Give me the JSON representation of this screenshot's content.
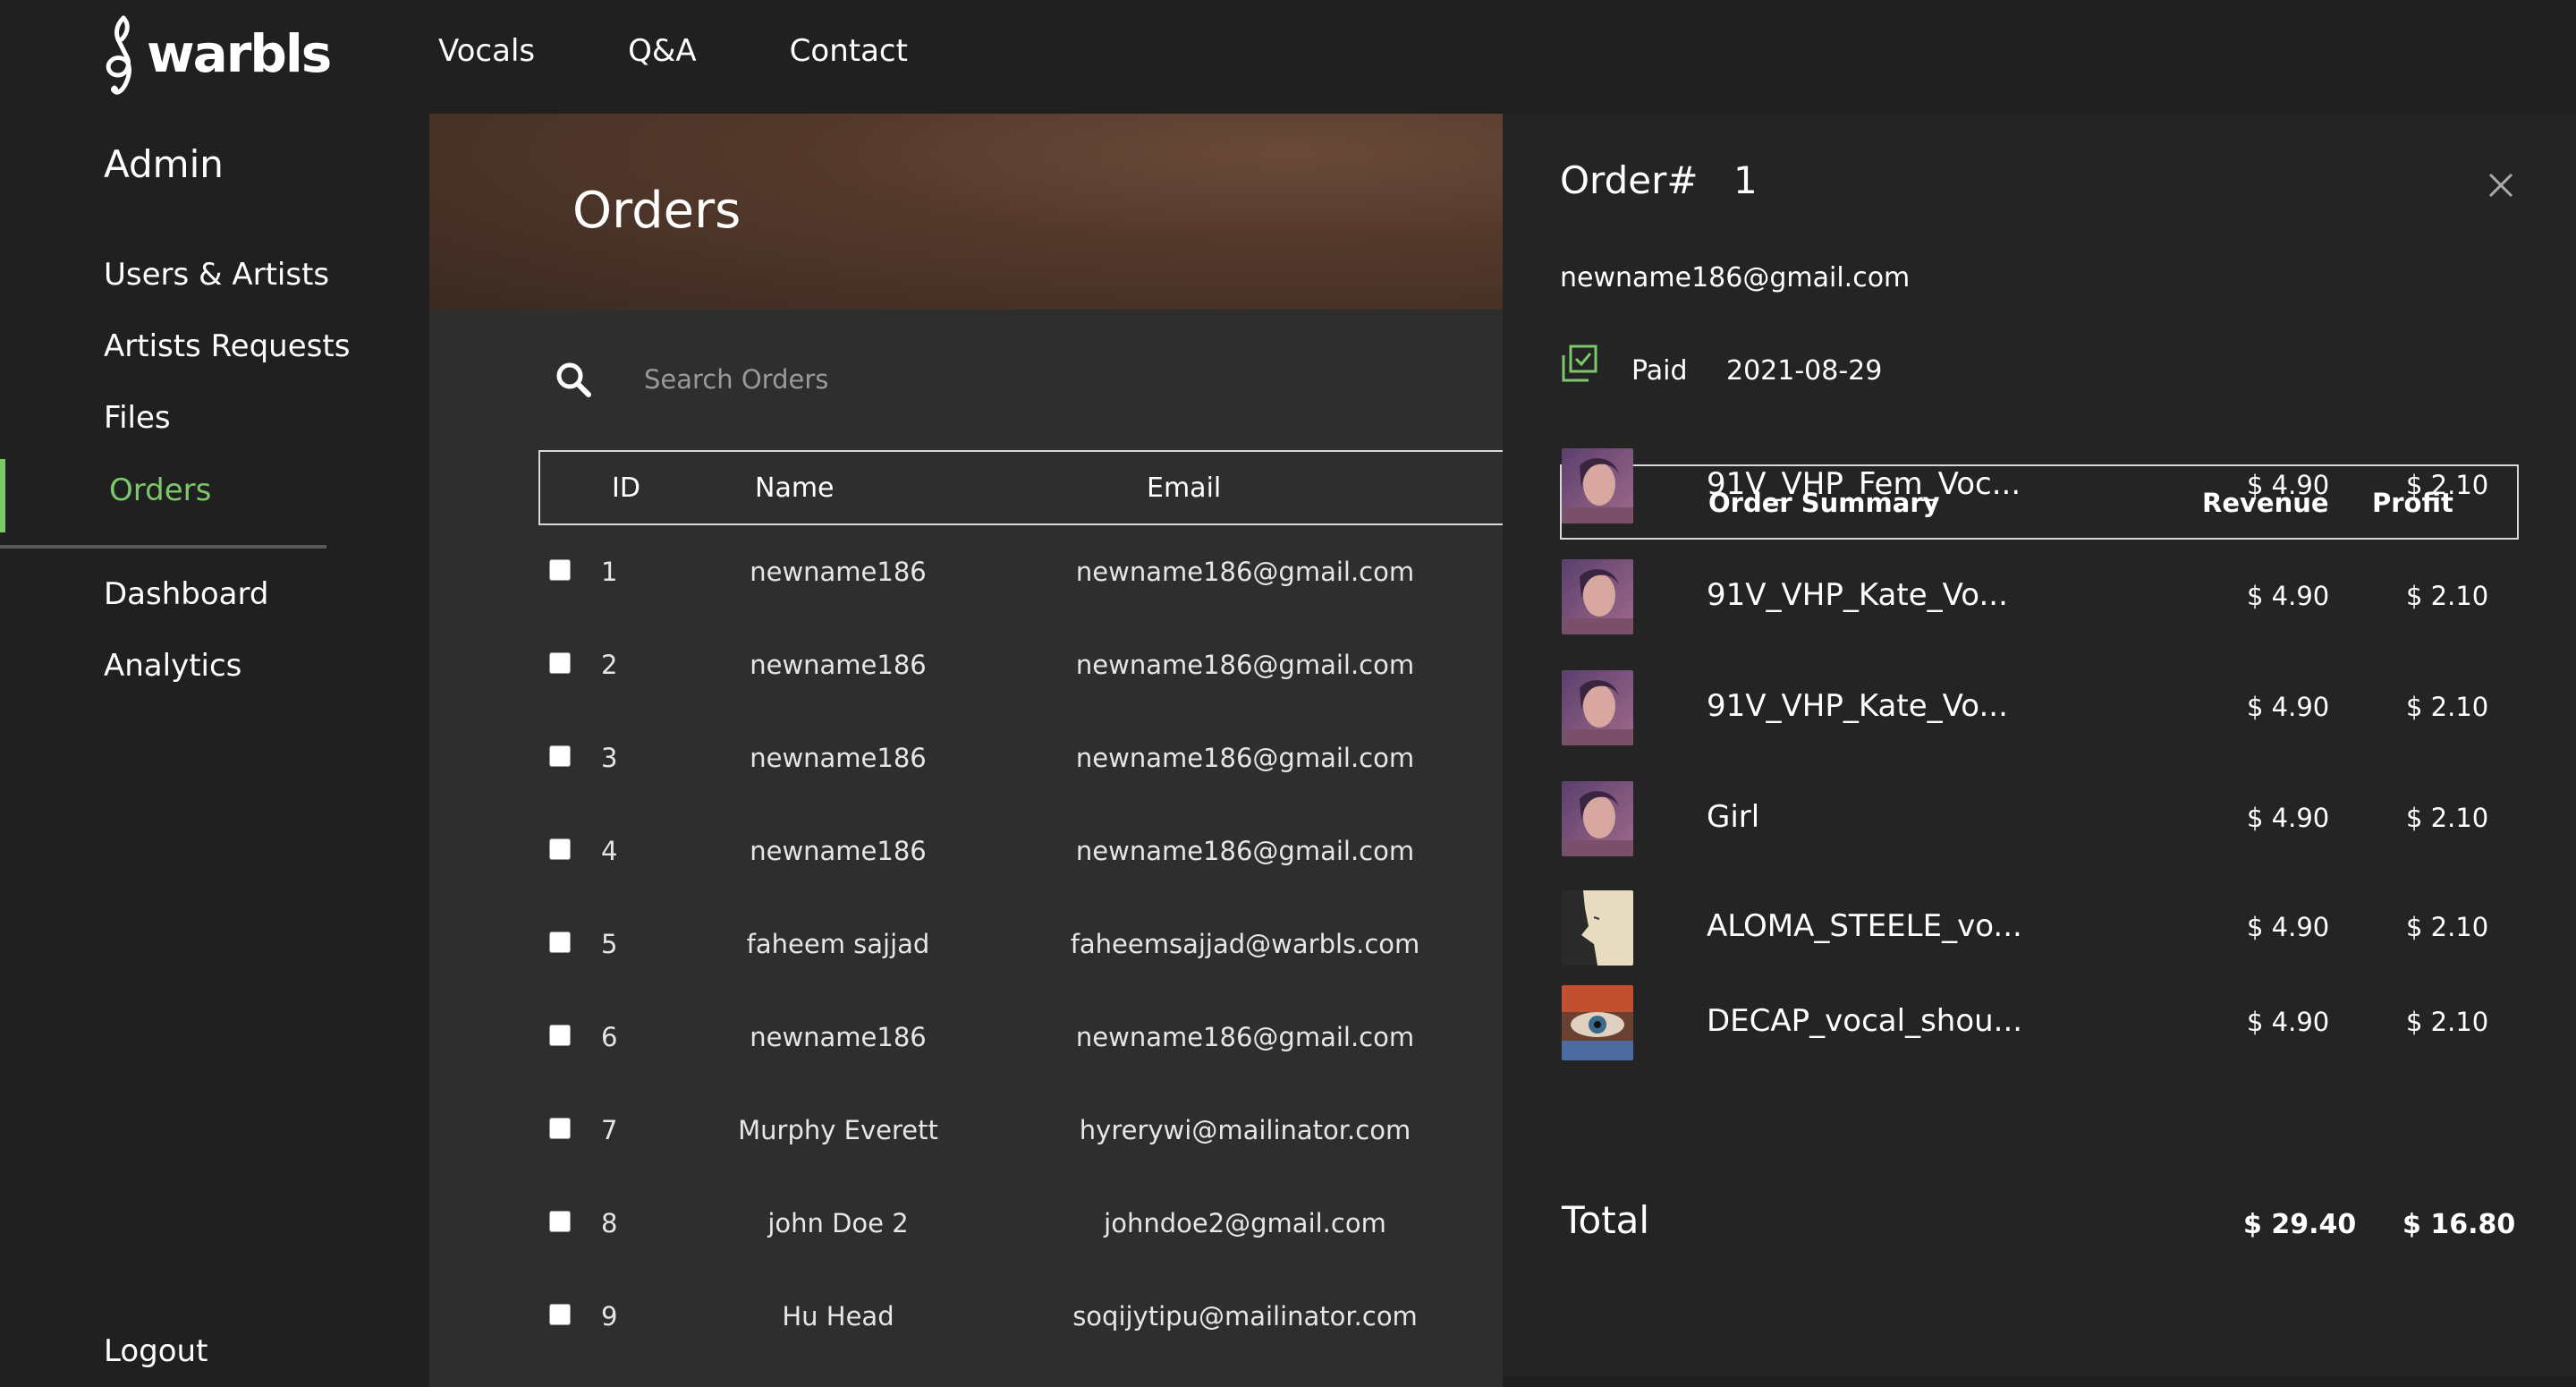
{
  "brand": {
    "name": "warbls"
  },
  "nav": [
    "Vocals",
    "Q&A",
    "Contact"
  ],
  "sidebar": {
    "title": "Admin",
    "items": [
      "Users & Artists",
      "Artists Requests",
      "Files",
      "Orders",
      "Dashboard",
      "Analytics"
    ],
    "active": "Orders",
    "logout": "Logout"
  },
  "colors": {
    "accent": "#7cc86a",
    "background": "#202020",
    "main": "#2e2e2e",
    "panel": "#242424"
  },
  "main": {
    "title": "Orders",
    "search": {
      "placeholder": "Search Orders"
    },
    "columns": [
      "ID",
      "Name",
      "Email"
    ],
    "date_prefix": "202",
    "rows": [
      {
        "id": "1",
        "name": "newname186",
        "email": "newname186@gmail.com"
      },
      {
        "id": "2",
        "name": "newname186",
        "email": "newname186@gmail.com"
      },
      {
        "id": "3",
        "name": "newname186",
        "email": "newname186@gmail.com"
      },
      {
        "id": "4",
        "name": "newname186",
        "email": "newname186@gmail.com"
      },
      {
        "id": "5",
        "name": "faheem sajjad",
        "email": "faheemsajjad@warbls.com"
      },
      {
        "id": "6",
        "name": "newname186",
        "email": "newname186@gmail.com"
      },
      {
        "id": "7",
        "name": "Murphy Everett",
        "email": "hyrerywi@mailinator.com"
      },
      {
        "id": "8",
        "name": "john Doe 2",
        "email": "johndoe2@gmail.com"
      },
      {
        "id": "9",
        "name": "Hu Head",
        "email": "soqijytipu@mailinator.com"
      }
    ]
  },
  "order": {
    "title": "Order#",
    "number": "1",
    "email": "newname186@gmail.com",
    "status": "Paid",
    "date": "2021-08-29",
    "summary_headers": {
      "summary": "Order Summary",
      "revenue": "Revenue",
      "profit": "Profit"
    },
    "items": [
      {
        "name": "91V_VHP_Fem_Voc...",
        "revenue": "$ 4.90",
        "profit": "$ 2.10",
        "thumb": "portrait"
      },
      {
        "name": "91V_VHP_Kate_Vo...",
        "revenue": "$ 4.90",
        "profit": "$ 2.10",
        "thumb": "portrait"
      },
      {
        "name": "91V_VHP_Kate_Vo...",
        "revenue": "$ 4.90",
        "profit": "$ 2.10",
        "thumb": "portrait"
      },
      {
        "name": "Girl",
        "revenue": "$ 4.90",
        "profit": "$ 2.10",
        "thumb": "portrait"
      },
      {
        "name": "ALOMA_STEELE_vo...",
        "revenue": "$ 4.90",
        "profit": "$ 2.10",
        "thumb": "face-profile"
      },
      {
        "name": "DECAP_vocal_shou...",
        "revenue": "$ 4.90",
        "profit": "$ 2.10",
        "thumb": "eye"
      }
    ],
    "total_label": "Total",
    "total_revenue": "$ 29.40",
    "total_profit": "$ 16.80"
  }
}
